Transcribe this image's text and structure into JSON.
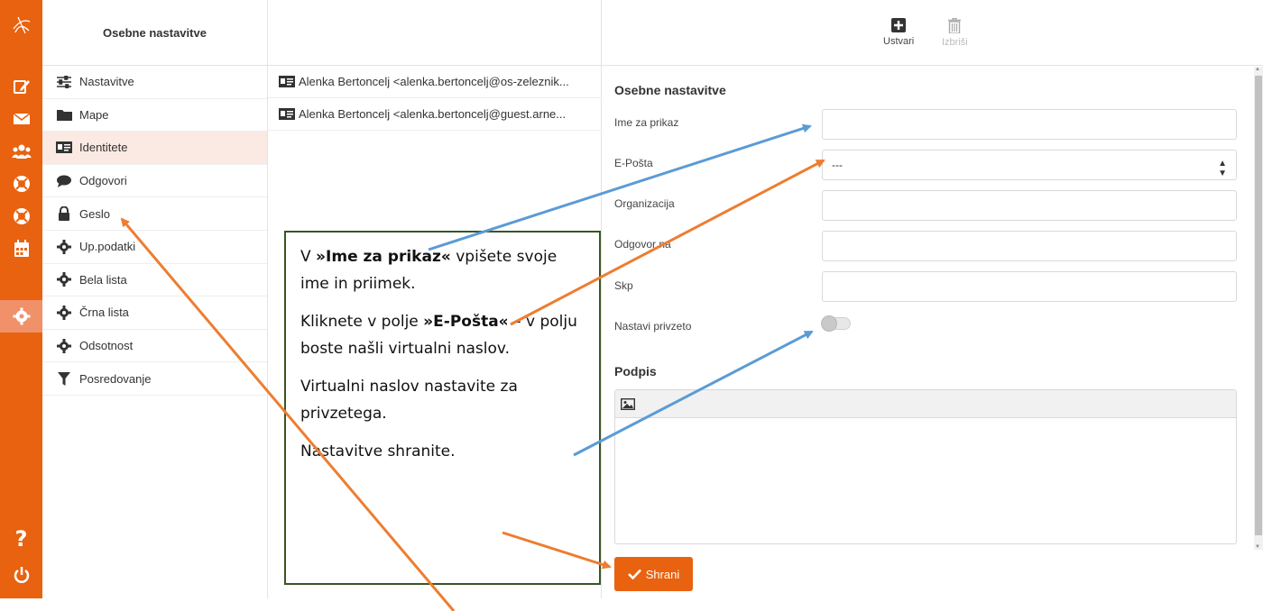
{
  "settings": {
    "header": "Osebne nastavitve",
    "items": [
      {
        "label": "Nastavitve",
        "icon": "sliders-icon"
      },
      {
        "label": "Mape",
        "icon": "folder-icon"
      },
      {
        "label": "Identitete",
        "icon": "id-card-icon"
      },
      {
        "label": "Odgovori",
        "icon": "comment-icon"
      },
      {
        "label": "Geslo",
        "icon": "lock-icon"
      },
      {
        "label": "Up.podatki",
        "icon": "gear-icon"
      },
      {
        "label": "Bela lista",
        "icon": "gear-icon"
      },
      {
        "label": "Črna lista",
        "icon": "gear-icon"
      },
      {
        "label": "Odsotnost",
        "icon": "gear-icon"
      },
      {
        "label": "Posredovanje",
        "icon": "filter-icon"
      }
    ],
    "selected": "Identitete"
  },
  "identities": [
    "Alenka Bertoncelj <alenka.bertoncelj@os-zeleznik...",
    "Alenka Bertoncelj <alenka.bertoncelj@guest.arne..."
  ],
  "toolbar": {
    "create_label": "Ustvari",
    "delete_label": "Izbriši"
  },
  "form": {
    "title": "Osebne nastavitve",
    "name_label": "Ime za prikaz",
    "name_value": "",
    "email_label": "E-Pošta",
    "email_value": "---",
    "org_label": "Organizacija",
    "org_value": "",
    "reply_label": "Odgovor na",
    "reply_value": "",
    "bcc_label": "Skp",
    "bcc_value": "",
    "default_label": "Nastavi privzeto",
    "default_on": false,
    "signature_title": "Podpis",
    "save_label": "Shrani"
  },
  "callout": {
    "p1_pre": "V ",
    "p1_bold": "»Ime za prikaz«",
    "p1_post": " vpišete svoje ime in priimek.",
    "p2_pre": "Kliknete v polje ",
    "p2_bold": "»E-Pošta«",
    "p2_post": " – v polju boste našli virtualni naslov.",
    "p3": "Virtualni naslov nastavite za privzetega.",
    "p4": "Nastavitve shranite."
  },
  "colors": {
    "accent": "#e8620f",
    "arrow_blue": "#5b9bd5",
    "arrow_orange": "#ed7d31",
    "callout_border": "#375623"
  }
}
